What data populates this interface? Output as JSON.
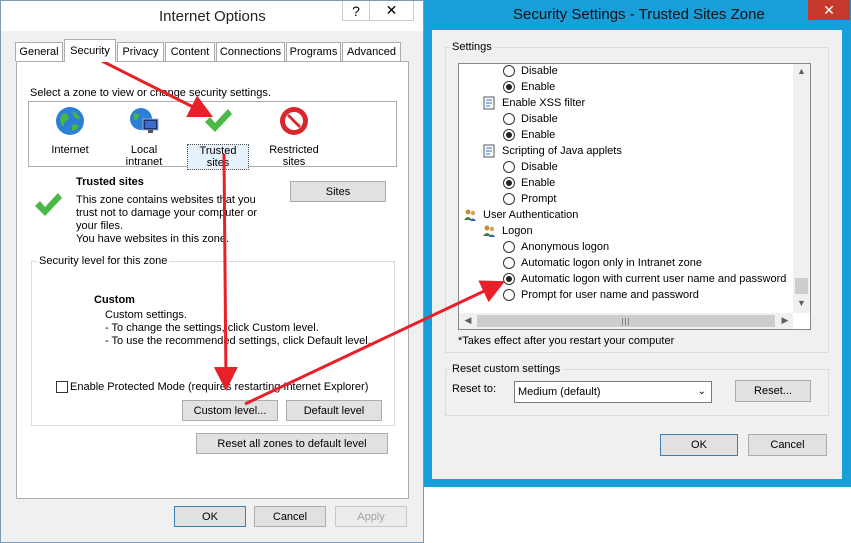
{
  "internet_options": {
    "title": "Internet Options",
    "help_btn": "?",
    "close_btn": "✕",
    "tabs": [
      "General",
      "Security",
      "Privacy",
      "Content",
      "Connections",
      "Programs",
      "Advanced"
    ],
    "zone_prompt": "Select a zone to view or change security settings.",
    "zones": [
      "Internet",
      "Local intranet",
      "Trusted sites",
      "Restricted sites"
    ],
    "selected_zone_title": "Trusted sites",
    "zone_description": [
      "This zone contains websites that you",
      "trust not to damage your computer or",
      "your files.",
      "You have websites in this zone."
    ],
    "sites_button": "Sites",
    "security_level_legend": "Security level for this zone",
    "custom_title": "Custom",
    "custom_lines": [
      "Custom settings.",
      "- To change the settings, click Custom level.",
      "- To use the recommended settings, click Default level."
    ],
    "protected_mode_label": "Enable Protected Mode (requires restarting Internet Explorer)",
    "custom_level_button": "Custom level...",
    "default_level_button": "Default level",
    "reset_all_button": "Reset all zones to default level",
    "ok_button": "OK",
    "cancel_button": "Cancel",
    "apply_button": "Apply"
  },
  "security_settings": {
    "title": "Security Settings - Trusted Sites Zone",
    "close_btn": "✕",
    "settings_legend": "Settings",
    "rows": [
      {
        "type": "radio",
        "label": "Disable",
        "checked": false
      },
      {
        "type": "radio",
        "label": "Enable",
        "checked": true
      },
      {
        "type": "header",
        "label": "Enable XSS filter"
      },
      {
        "type": "radio",
        "label": "Disable",
        "checked": false
      },
      {
        "type": "radio",
        "label": "Enable",
        "checked": true
      },
      {
        "type": "header",
        "label": "Scripting of Java applets"
      },
      {
        "type": "radio",
        "label": "Disable",
        "checked": false
      },
      {
        "type": "radio",
        "label": "Enable",
        "checked": true
      },
      {
        "type": "radio",
        "label": "Prompt",
        "checked": false
      },
      {
        "type": "category",
        "label": "User Authentication"
      },
      {
        "type": "subcategory",
        "label": "Logon"
      },
      {
        "type": "radio",
        "label": "Anonymous logon",
        "checked": false
      },
      {
        "type": "radio",
        "label": "Automatic logon only in Intranet zone",
        "checked": false
      },
      {
        "type": "radio",
        "label": "Automatic logon with current user name and password",
        "checked": true
      },
      {
        "type": "radio",
        "label": "Prompt for user name and password",
        "checked": false
      }
    ],
    "restart_note": "*Takes effect after you restart your computer",
    "reset_legend": "Reset custom settings",
    "reset_to_label": "Reset to:",
    "reset_to_value": "Medium (default)",
    "reset_button": "Reset...",
    "ok_button": "OK",
    "cancel_button": "Cancel"
  },
  "colors": {
    "annotation_red": "#e8202a",
    "titlebar_blue": "#1a9ed9",
    "close_red": "#c7392d"
  }
}
